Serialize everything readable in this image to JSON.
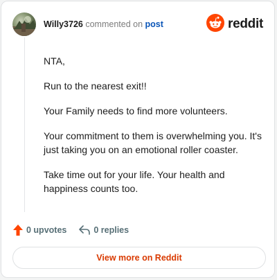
{
  "header": {
    "username": "Willy3726",
    "commented_on": "commented on",
    "post_link": "post",
    "brand_name": "reddit"
  },
  "comment": {
    "paragraphs": [
      "NTA,",
      "Run to the nearest exit!!",
      "Your Family needs to find more volunteers.",
      "Your commitment to them is overwhelming you. It's just taking you on an emotional roller coaster.",
      "Take time out for your life. Your health and happiness counts too."
    ]
  },
  "actions": {
    "upvotes_label": "0 upvotes",
    "replies_label": "0 replies"
  },
  "footer": {
    "view_more_label": "View more on Reddit"
  },
  "colors": {
    "brand": "#ff4500",
    "link": "#0a55b8",
    "cta": "#d93a00"
  },
  "icons": {
    "avatar": "user-avatar",
    "brand": "reddit-snoo-icon",
    "upvote": "upvote-arrow-icon",
    "reply": "reply-arrow-icon"
  }
}
